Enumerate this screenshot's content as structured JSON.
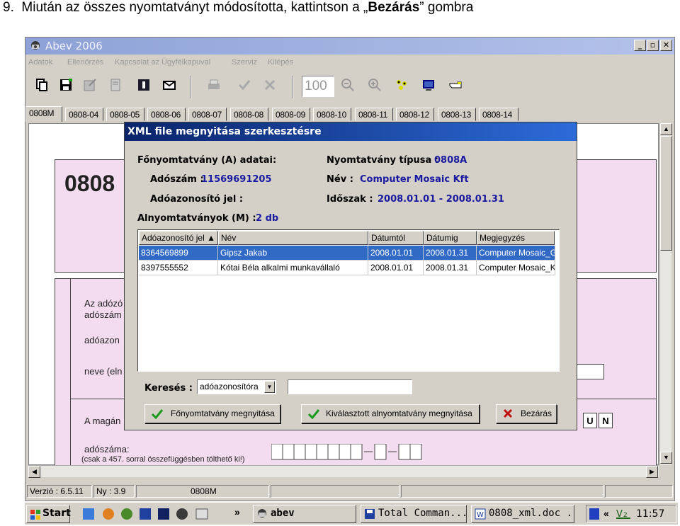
{
  "instruction": {
    "num": "9.",
    "pre": "Miután az összes nyomtatványt módosította, kattintson a „",
    "bold": "Bezárás",
    "post": "” gombra"
  },
  "window": {
    "title": "Abev 2006",
    "menu": [
      "Adatok",
      "Ellenőrzés",
      "Kapcsolat az Ügyfélkapuval",
      "Szerviz",
      "Kilépés"
    ],
    "zoom": "100",
    "tabs": [
      "0808M",
      "0808-04",
      "0808-05",
      "0808-06",
      "0808-07",
      "0808-08",
      "0808-09",
      "0808-10",
      "0808-11",
      "0808-12",
      "0808-13",
      "0808-14"
    ]
  },
  "form": {
    "code": "0808",
    "label1a": "Az adózó",
    "label1b": "adószám",
    "label2": "adóazon",
    "label3": "neve (eln",
    "label4": "A magán",
    "label5": "adószáma:",
    "label6": "(csak a 457. sorral összefüggésben tölthető ki!)",
    "letters": [
      "U",
      "N"
    ]
  },
  "status": {
    "version": "Verzió : 6.5.11",
    "ny": "Ny : 3.9",
    "form": "0808M"
  },
  "dialog": {
    "title": "XML file megnyitása szerkesztésre",
    "main_label": "Főnyomtatvány (A) adatai:",
    "adoszam_label": "Adószám :",
    "adoszam_value": "11569691205",
    "adoazon_label": "Adóazonosító jel :",
    "type_label": "Nyomtatvány típusa :",
    "type_value": "0808A",
    "name_label": "Név :",
    "name_value": "Computer Mosaic Kft",
    "period_label": "Időszak :",
    "period_value": "2008.01.01 - 2008.01.31",
    "sub_label": "Alnyomtatványok (M) :",
    "sub_count": "2 db",
    "columns": [
      "Adóazonosító jel ▲",
      "Név",
      "Dátumtól",
      "Dátumig",
      "Megjegyzés"
    ],
    "rows": [
      [
        "8364569899",
        "Gipsz Jakab",
        "2008.01.01",
        "2008.01.31",
        "Computer Mosaic_G"
      ],
      [
        "8397555552",
        "Kótai Béla alkalmi munkavállaló",
        "2008.01.01",
        "2008.01.31",
        "Computer Mosaic_K"
      ]
    ],
    "search_label": "Keresés :",
    "search_select": "adóazonosítóra",
    "search_value": "",
    "btn_main": "Főnyomtatvány megnyitása",
    "btn_selected": "Kiválasztott alnyomtatvány megnyitása",
    "btn_close": "Bezárás"
  },
  "taskbar": {
    "start": "Start",
    "tasks": [
      "abev",
      "Total Comman...",
      "0808_xml.doc ..."
    ],
    "clock": "11:57",
    "chevron": "»",
    "tray_chevron": "«"
  }
}
